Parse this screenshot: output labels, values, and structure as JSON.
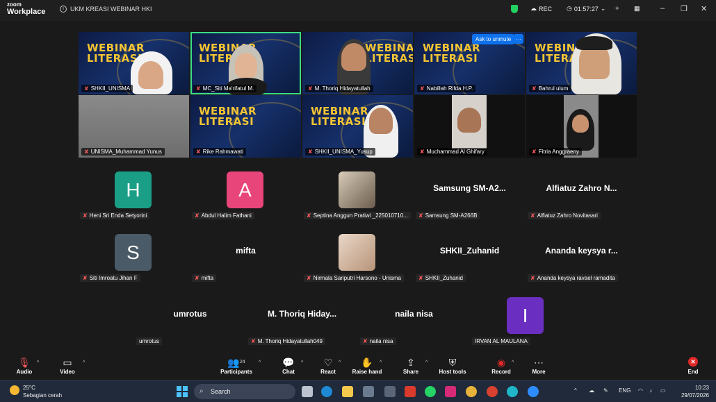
{
  "app": {
    "logo_line1": "zoom",
    "logo_line2": "Workplace",
    "meeting_title": "UKM KREASI WEBINAR HKI",
    "rec_label": "REC",
    "timer": "01:57:27"
  },
  "banner": {
    "word1": "WEBINAR",
    "word2": "LITERASI"
  },
  "video_tiles": [
    {
      "name": "SHKII_UNISMA"
    },
    {
      "name": "MC_Siti Ma'rifatul M."
    },
    {
      "name": "M. Thoriq Hidayatullah"
    },
    {
      "name": "Nabillah Rifda H.P.",
      "ask_label": "Ask to unmute",
      "more_label": "…"
    },
    {
      "name": "Bahrul ulum"
    },
    {
      "name": "UNISMA_Muhammad Yunus"
    },
    {
      "name": "Rike Rahmawati"
    },
    {
      "name": "SHKII_UNISMA_Yusup"
    },
    {
      "name": "Muchammad Al Ghifary"
    },
    {
      "name": "Fitria Anggraeny"
    }
  ],
  "participants": [
    {
      "avatar": "H",
      "name": "Heni Sri Enda Setyorini",
      "color": "#1a9e86"
    },
    {
      "avatar": "A",
      "name": "Abdul Halim Fathani",
      "color": "#e8457a"
    },
    {
      "name": "Septina Anggun Pratiwi _225010710..."
    },
    {
      "big": "Samsung SM-A2...",
      "name": "Samsung SM-A266B"
    },
    {
      "big": "Alfiatuz Zahro N...",
      "name": "Alfiatuz Zahro Novitasari"
    },
    {
      "avatar": "S",
      "name": "Siti Imroatu Jihan F",
      "color": "#4a5a66"
    },
    {
      "big": "mifta",
      "name": "mifta"
    },
    {
      "name": "Nirmala Sariputri Harsono - Unisma"
    },
    {
      "big": "SHKII_Zuhanid",
      "name": "SHKII_Zuhanid"
    },
    {
      "big": "Ananda keysya r...",
      "name": "Ananda keysya ravael ramadita"
    },
    {
      "big": "umrotus",
      "name": "umrotus"
    },
    {
      "big": "M. Thoriq Hiday...",
      "name": "M. Thoriq Hidayatullah049"
    },
    {
      "big": "naila nisa",
      "name": "naila nisa"
    },
    {
      "avatar": "I",
      "name": "IRVAN AL MAULANA",
      "color": "#6a2fc0"
    }
  ],
  "toolbar": {
    "audio": "Audio",
    "video": "Video",
    "participants": "Participants",
    "participants_count": "24",
    "chat": "Chat",
    "react": "React",
    "raise_hand": "Raise hand",
    "share": "Share",
    "host_tools": "Host tools",
    "record": "Record",
    "more": "More",
    "end": "End"
  },
  "taskbar": {
    "temp": "25°C",
    "weather": "Sebagian cerah",
    "search": "Search",
    "lang": "ENG",
    "time": "10:23",
    "date": "29/07/2026"
  },
  "colors": {
    "active_speaker": "#3ddc84",
    "mic_muted": "#ff5a5a",
    "accent_blue": "#0e72ed",
    "end_red": "#e02828"
  }
}
